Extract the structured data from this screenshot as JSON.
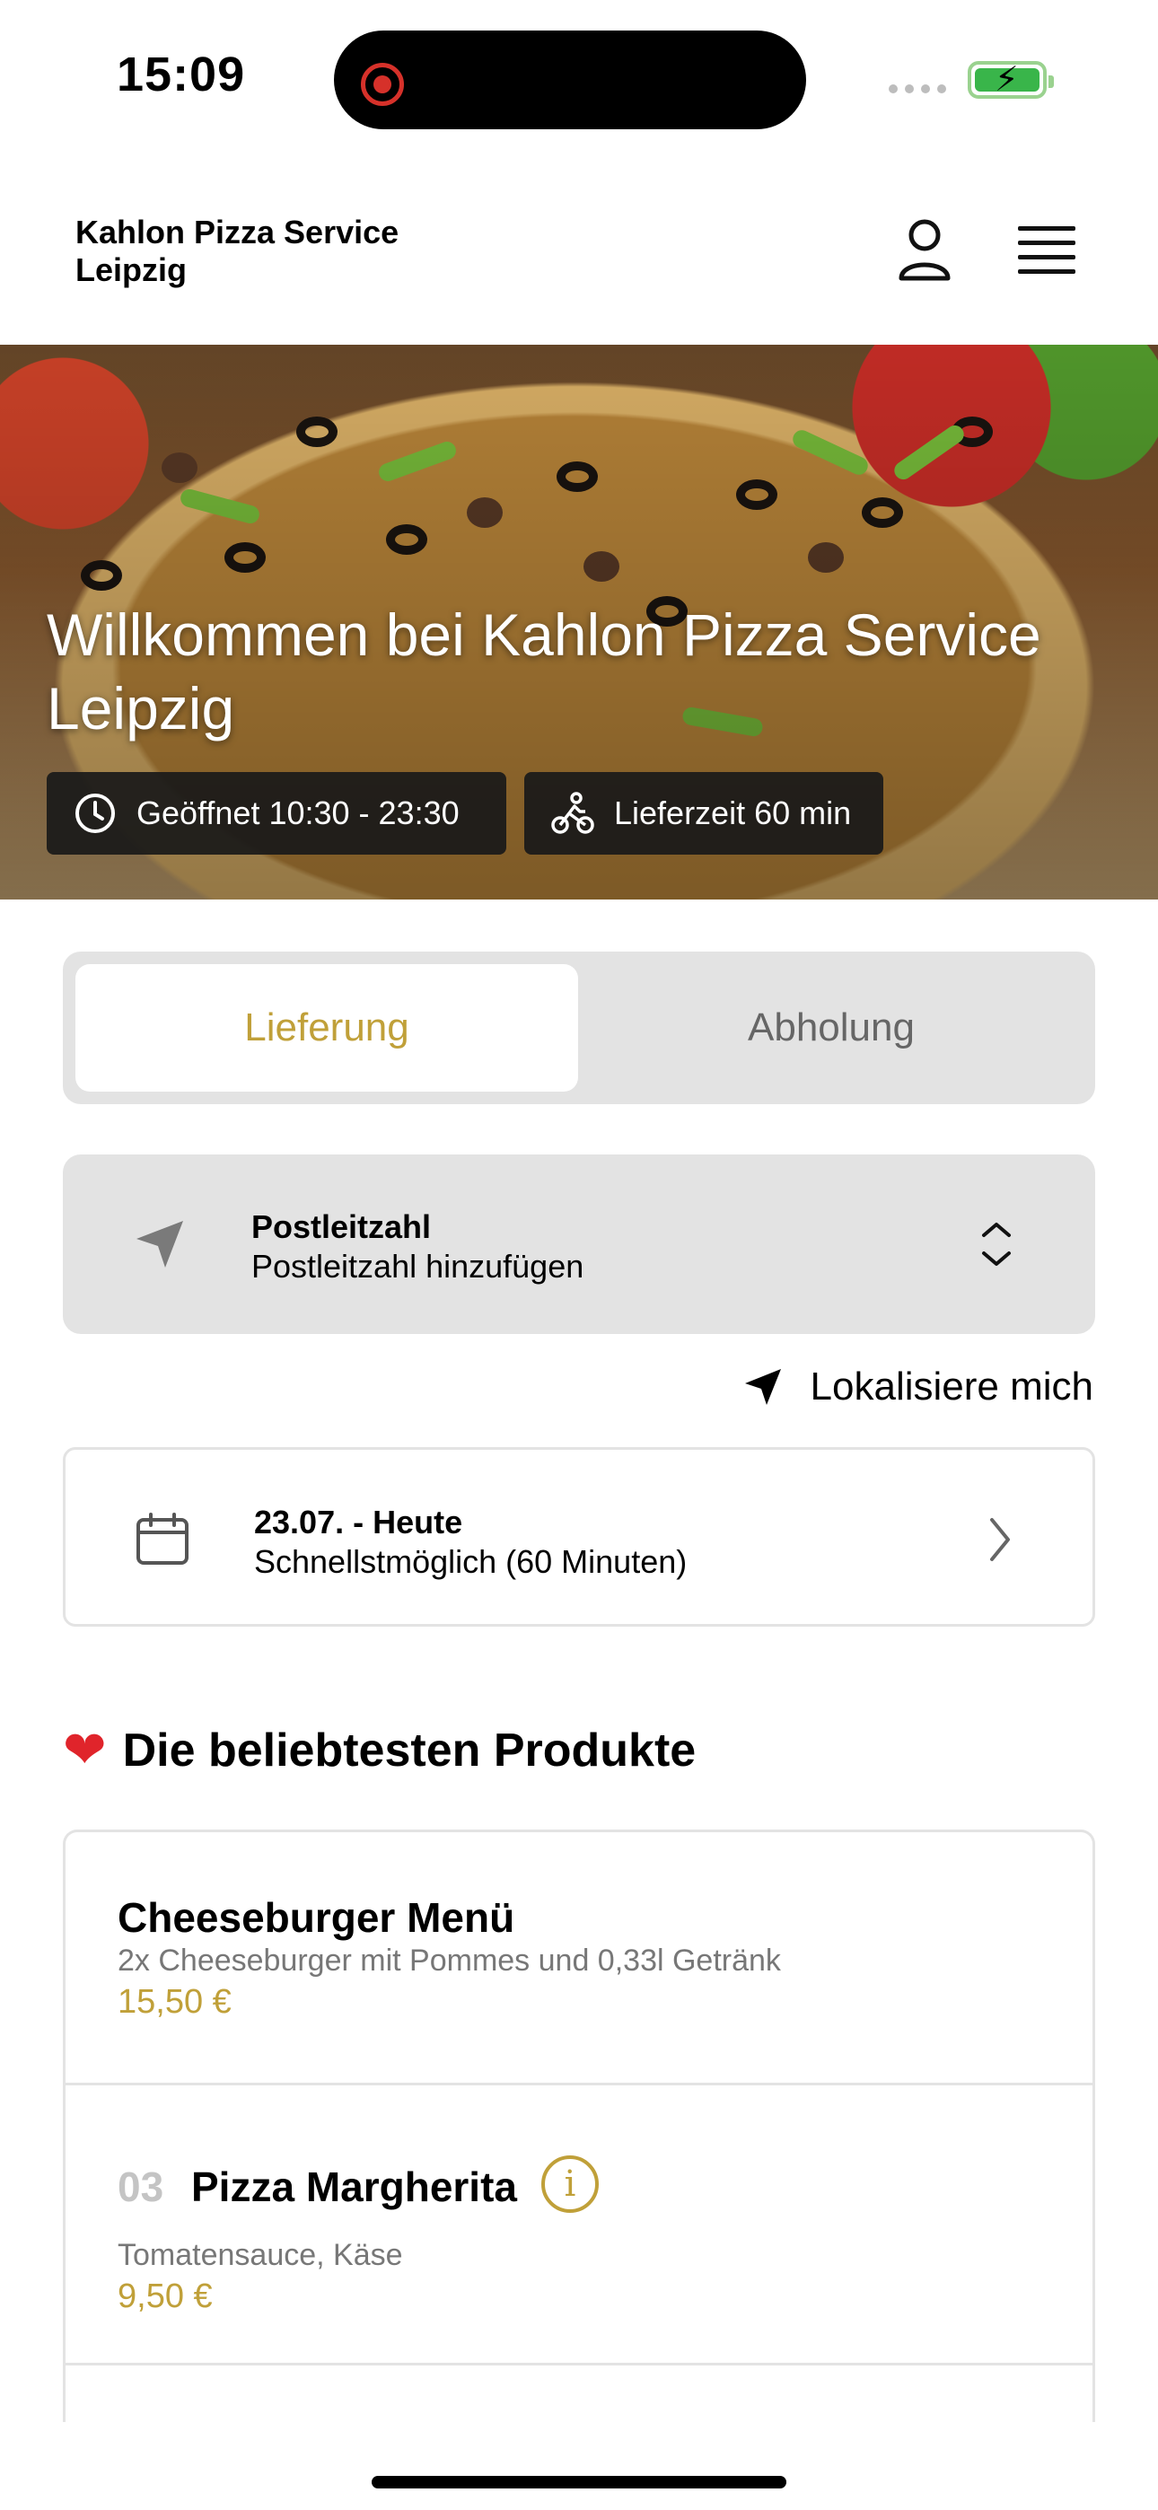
{
  "status_bar": {
    "time": "15:09"
  },
  "header": {
    "brand_line1": "Kahlon Pizza Service",
    "brand_line2": "Leipzig"
  },
  "hero": {
    "title": "Willkommen bei Kahlon Pizza Service Leipzig",
    "opening_hours": "Geöffnet 10:30 - 23:30",
    "delivery_time": "Lieferzeit 60 min"
  },
  "order_mode": {
    "tabs": [
      {
        "label": "Lieferung",
        "selected": true
      },
      {
        "label": "Abholung",
        "selected": false
      }
    ],
    "accent_color": "#c0a039"
  },
  "postcode": {
    "title": "Postleitzahl",
    "placeholder": "Postleitzahl hinzufügen"
  },
  "locate": {
    "label": "Lokalisiere mich"
  },
  "schedule": {
    "date": "23.07. - Heute",
    "time": "Schnellstmöglich (60 Minuten)"
  },
  "popular": {
    "title": "Die beliebtesten Produkte",
    "products": [
      {
        "name": "Cheeseburger Menü",
        "description": "2x Cheeseburger mit Pommes und 0,33l Getränk",
        "price": "15,50 €"
      },
      {
        "number": "03",
        "name": "Pizza Margherita",
        "description": "Tomatensauce, Käse",
        "price": "9,50 €"
      }
    ]
  }
}
